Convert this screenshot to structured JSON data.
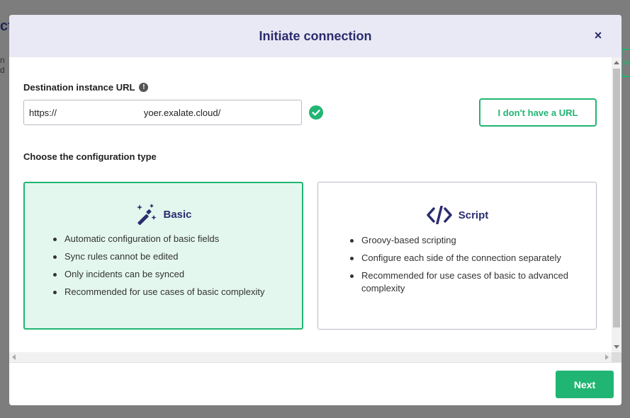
{
  "background": {
    "title_fragment": "ct",
    "text_fragment": "n d",
    "button_fragment": "vi"
  },
  "modal": {
    "title": "Initiate connection",
    "close_glyph": "×",
    "url_field": {
      "label": "Destination instance URL",
      "info_glyph": "!",
      "value": "https://                                  yoer.exalate.cloud/",
      "valid": true
    },
    "no_url_button": "I don't have a URL",
    "config_label": "Choose the configuration type",
    "options": [
      {
        "id": "basic",
        "title": "Basic",
        "icon": "magic-wand-icon",
        "selected": true,
        "bullets": [
          "Automatic configuration of basic fields",
          "Sync rules cannot be edited",
          "Only incidents can be synced",
          "Recommended for use cases of basic complexity"
        ]
      },
      {
        "id": "script",
        "title": "Script",
        "icon": "code-icon",
        "selected": false,
        "bullets": [
          "Groovy-based scripting",
          "Configure each side of the connection separately",
          "Recommended for use cases of basic to advanced complexity"
        ]
      }
    ],
    "next_button": "Next"
  },
  "colors": {
    "accent_green": "#21b573",
    "brand_navy": "#2b2c6e",
    "header_bg": "#e9e9f5",
    "selected_card_bg": "#e3f7ee",
    "overlay": "#7d7d7d"
  }
}
